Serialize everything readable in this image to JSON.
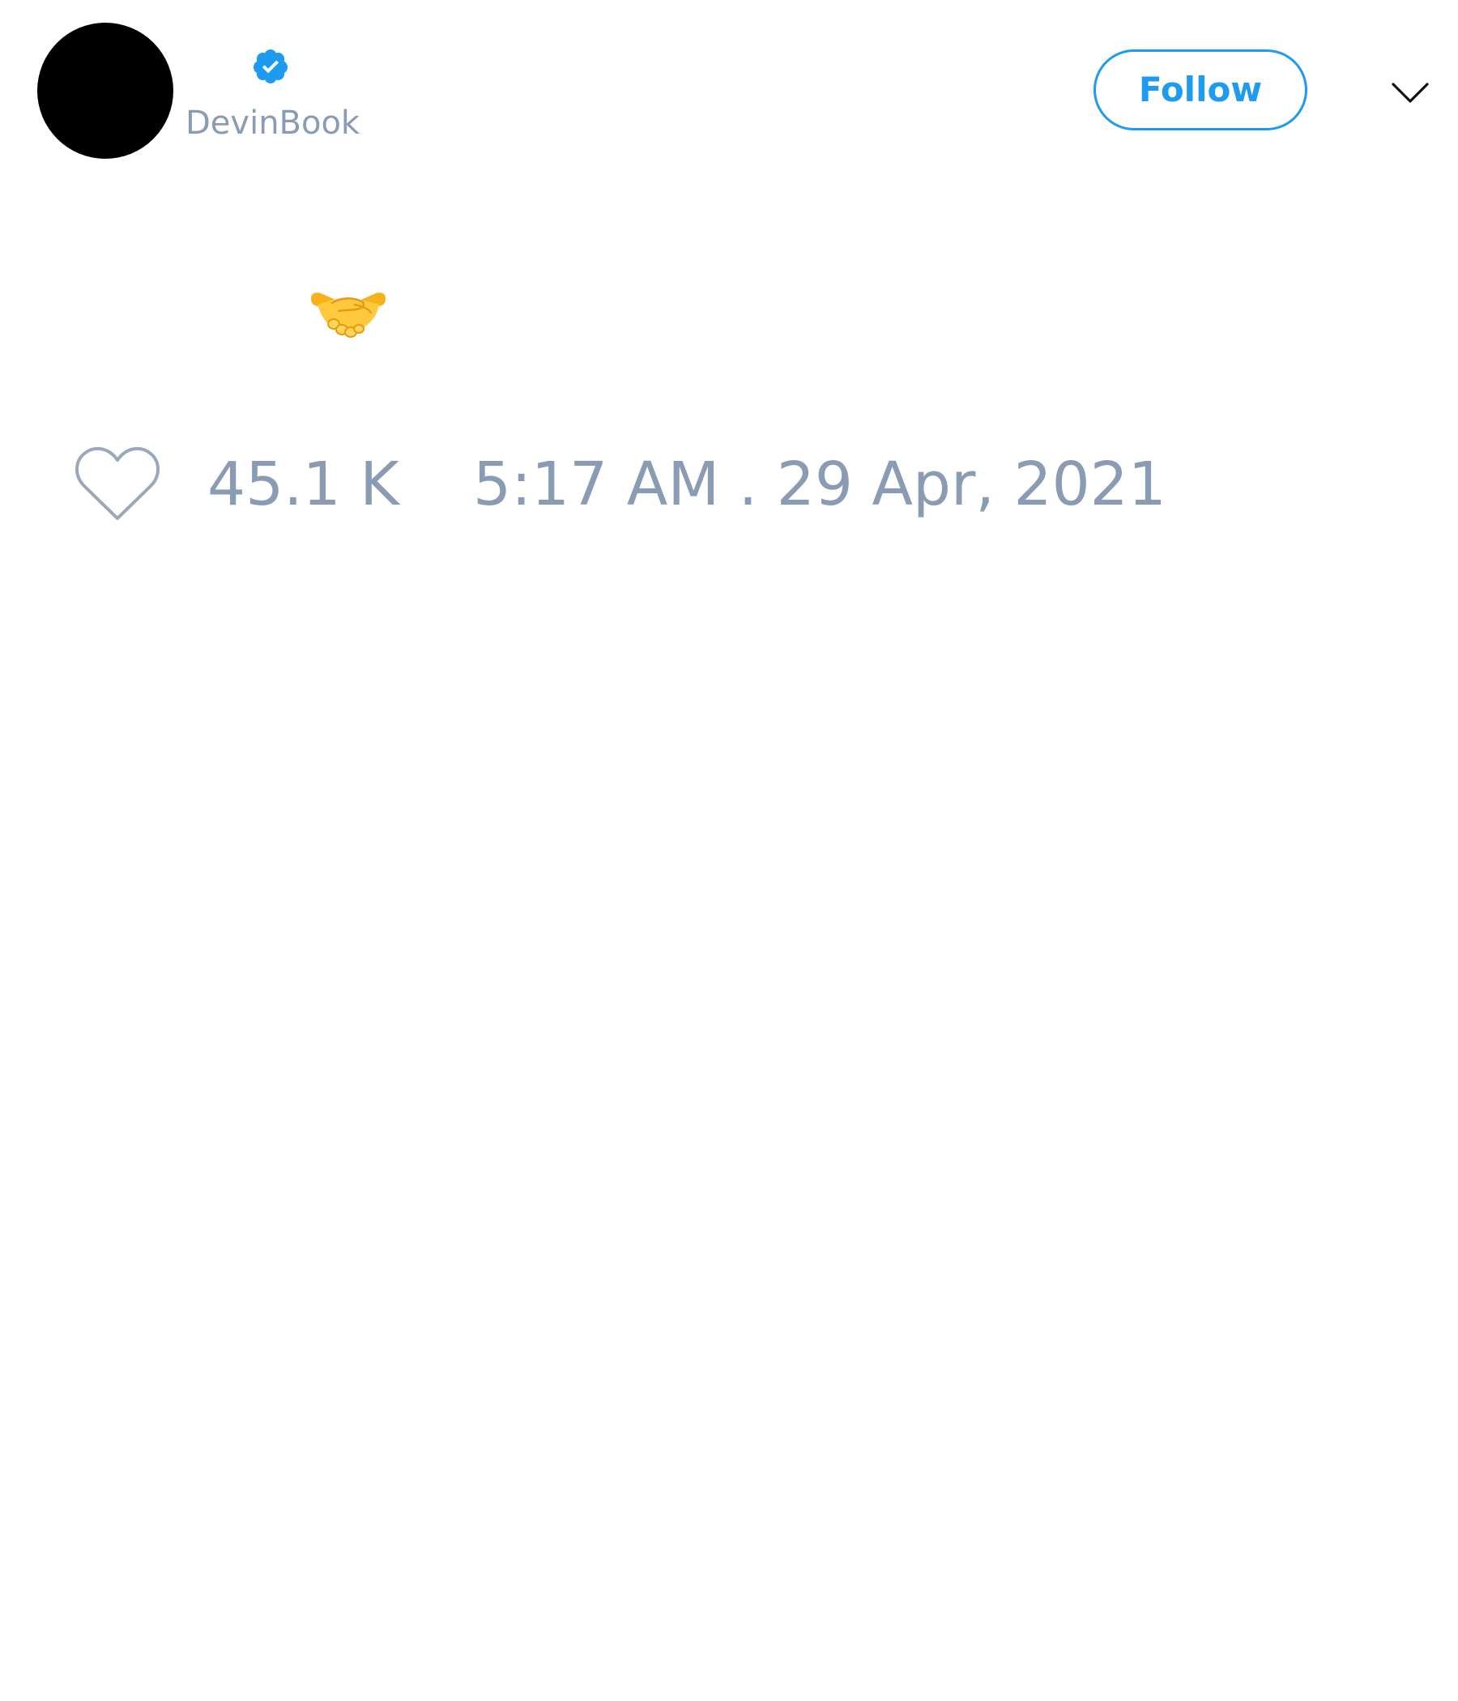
{
  "user": {
    "username": "DevinBook",
    "verified_icon": "verified-badge-icon"
  },
  "actions": {
    "follow_label": "Follow",
    "menu_icon": "chevron-down-icon"
  },
  "tweet": {
    "emoji": "🤝",
    "emoji_icon": "handshake-emoji-icon"
  },
  "engagement": {
    "like_icon": "heart-outline-icon",
    "likes": "45.1 K",
    "timestamp": "5:17 AM . 29 Apr, 2021"
  },
  "colors": {
    "accent": "#1d9bf0",
    "muted_text": "#8a9bb4",
    "avatar": "#000000"
  }
}
